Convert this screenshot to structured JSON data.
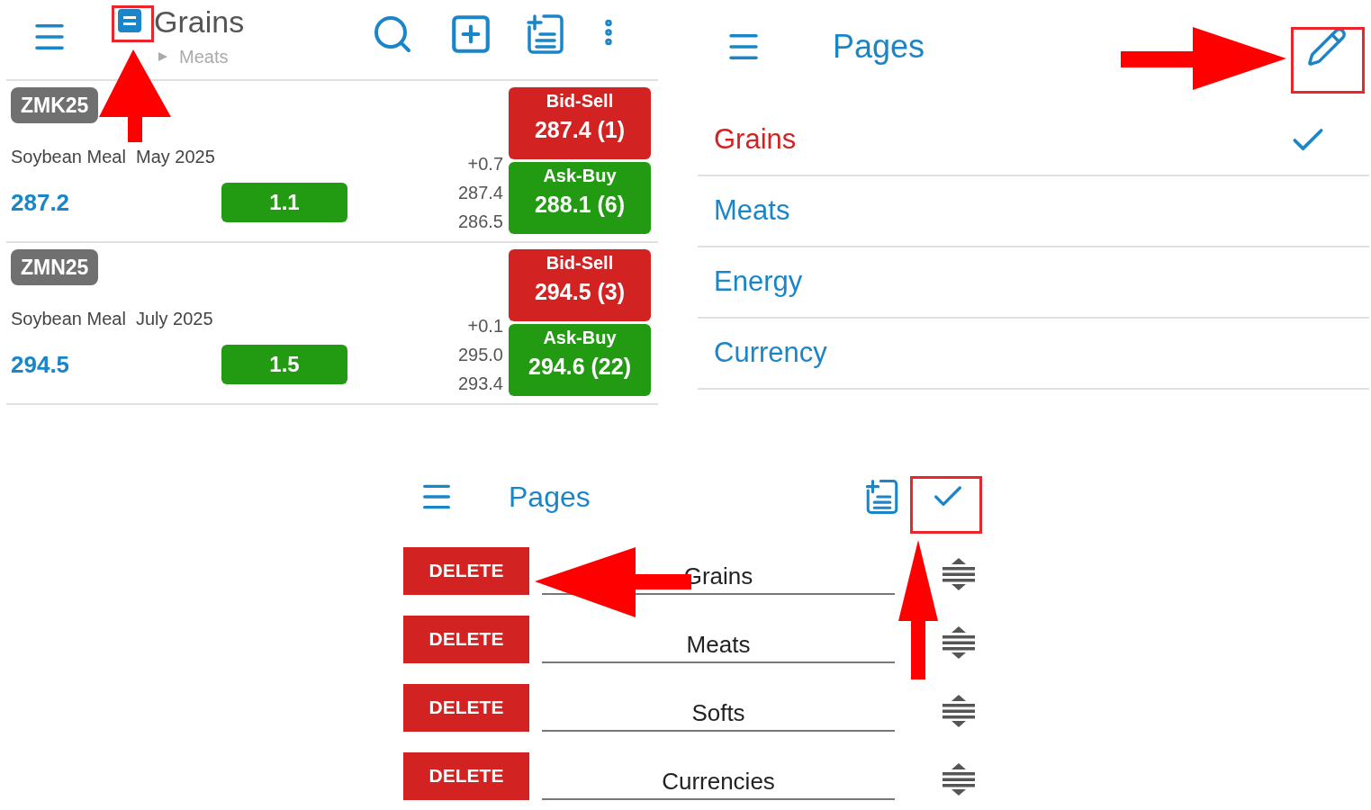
{
  "quotes_screen": {
    "title": "Grains",
    "subtitle": "Meats",
    "contracts": [
      {
        "symbol": "ZMK25",
        "name": "Soybean Meal  May 2025",
        "last": "287.2",
        "change": "1.1",
        "net": "+0.7",
        "high": "287.4",
        "low": "286.5",
        "bid_label": "Bid-Sell",
        "bid": "287.4 (1)",
        "ask_label": "Ask-Buy",
        "ask": "288.1 (6)"
      },
      {
        "symbol": "ZMN25",
        "name": "Soybean Meal  July 2025",
        "last": "294.5",
        "change": "1.5",
        "net": "+0.1",
        "high": "295.0",
        "low": "293.4",
        "bid_label": "Bid-Sell",
        "bid": "294.5 (3)",
        "ask_label": "Ask-Buy",
        "ask": "294.6 (22)"
      }
    ]
  },
  "pages_screen": {
    "title": "Pages",
    "items": [
      {
        "label": "Grains",
        "selected": true
      },
      {
        "label": "Meats",
        "selected": false
      },
      {
        "label": "Energy",
        "selected": false
      },
      {
        "label": "Currency",
        "selected": false
      }
    ]
  },
  "edit_pages_screen": {
    "title": "Pages",
    "items": [
      {
        "label": "Grains",
        "action": "DELETE"
      },
      {
        "label": "Meats",
        "action": "DELETE"
      },
      {
        "label": "Softs",
        "action": "DELETE"
      },
      {
        "label": "Currencies",
        "action": "DELETE"
      }
    ]
  }
}
